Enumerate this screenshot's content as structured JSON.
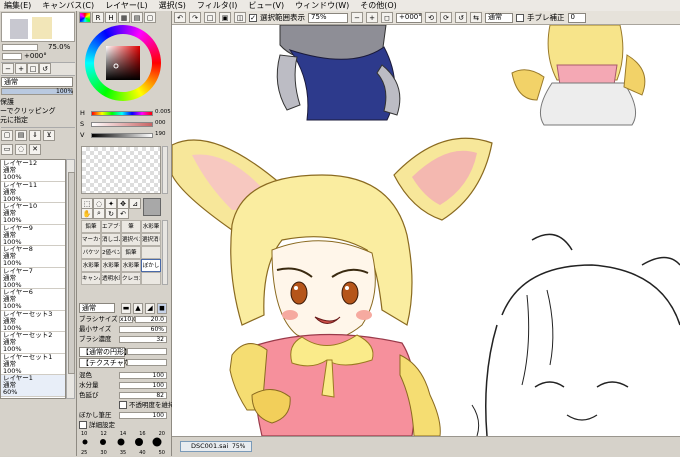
{
  "menubar": [
    "編集(E)",
    "キャンバス(C)",
    "レイヤー(L)",
    "選択(S)",
    "フィルタ(I)",
    "ビュー(V)",
    "ウィンドウ(W)",
    "その他(O)"
  ],
  "toolbar": {
    "selection_label": "選択範囲表示",
    "zoom": "75%",
    "rotation": "+000°",
    "blend_mode": "通常",
    "stabilizer_label": "手ブレ補正",
    "stabilizer_value": "0"
  },
  "navigator": {
    "zoom": "75.0%",
    "angle": "+000°"
  },
  "layer_panel": {
    "mode": "通常",
    "opacity": "100%",
    "options": [
      "保護",
      "ーでクリッピング",
      "元に指定"
    ],
    "layers": [
      {
        "name": "レイヤー12",
        "mode": "通常",
        "opacity": "100%"
      },
      {
        "name": "レイヤー11",
        "mode": "通常",
        "opacity": "100%"
      },
      {
        "name": "レイヤー10",
        "mode": "通常",
        "opacity": "100%"
      },
      {
        "name": "レイヤー9",
        "mode": "通常",
        "opacity": "100%"
      },
      {
        "name": "レイヤー8",
        "mode": "通常",
        "opacity": "100%"
      },
      {
        "name": "レイヤー7",
        "mode": "通常",
        "opacity": "100%"
      },
      {
        "name": "レイヤー6",
        "mode": "通常",
        "opacity": "100%"
      },
      {
        "name": "レイヤーセット3",
        "mode": "通常",
        "opacity": "100%"
      },
      {
        "name": "レイヤーセット2",
        "mode": "通常",
        "opacity": "100%"
      },
      {
        "name": "レイヤーセット1",
        "mode": "通常",
        "opacity": "100%"
      },
      {
        "name": "レイヤー1",
        "mode": "通常",
        "opacity": "60%"
      }
    ]
  },
  "color": {
    "h_label": "H",
    "h_value": "0.005",
    "s_label": "S",
    "s_value": "000",
    "v_label": "V",
    "v_value": "190"
  },
  "tools": [
    {
      "label": "鉛筆",
      "sel": false
    },
    {
      "label": "エアブラシ",
      "sel": false
    },
    {
      "label": "筆",
      "sel": false
    },
    {
      "label": "水彩筆",
      "sel": false
    },
    {
      "label": "マーカー",
      "sel": false
    },
    {
      "label": "消しゴム",
      "sel": false
    },
    {
      "label": "選択ペン",
      "sel": false
    },
    {
      "label": "選択消し",
      "sel": false
    },
    {
      "label": "バケツ",
      "sel": false
    },
    {
      "label": "2値ペン",
      "sel": false
    },
    {
      "label": "鉛筆",
      "sel": false
    },
    {
      "label": "",
      "sel": false
    },
    {
      "label": "水彩筆",
      "sel": false
    },
    {
      "label": "水彩筆",
      "sel": false
    },
    {
      "label": "水彩筆",
      "sel": false
    },
    {
      "label": "ぼかし",
      "sel": true
    },
    {
      "label": "キャンバス",
      "sel": false
    },
    {
      "label": "透明水彩",
      "sel": false
    },
    {
      "label": "クレヨン",
      "sel": false
    },
    {
      "label": "",
      "sel": false
    }
  ],
  "brush": {
    "mode": "通常",
    "size_label": "ブラシサイズ",
    "size_mult": "x10.0",
    "size_value": "20.0",
    "min_label": "最小サイズ",
    "min_value": "60%",
    "density_label": "ブラシ濃度",
    "density_value": "32",
    "shape_label": "【通常の円形】",
    "texture_label": "【テクスチャなし】",
    "mix_label": "混色",
    "mix_value": "100",
    "water_label": "水分量",
    "water_value": "100",
    "stretch_label": "色延び",
    "stretch_value": "82",
    "keep_opacity_label": "不透明度を維持",
    "blur_label": "ぼかし筆圧",
    "blur_value": "100",
    "detail_label": "詳細設定",
    "size_presets": [
      "10",
      "12",
      "14",
      "16",
      "20",
      "25",
      "30",
      "35",
      "40",
      "50"
    ]
  },
  "status": {
    "filename": "DSC001.sai",
    "percent": "75%"
  }
}
